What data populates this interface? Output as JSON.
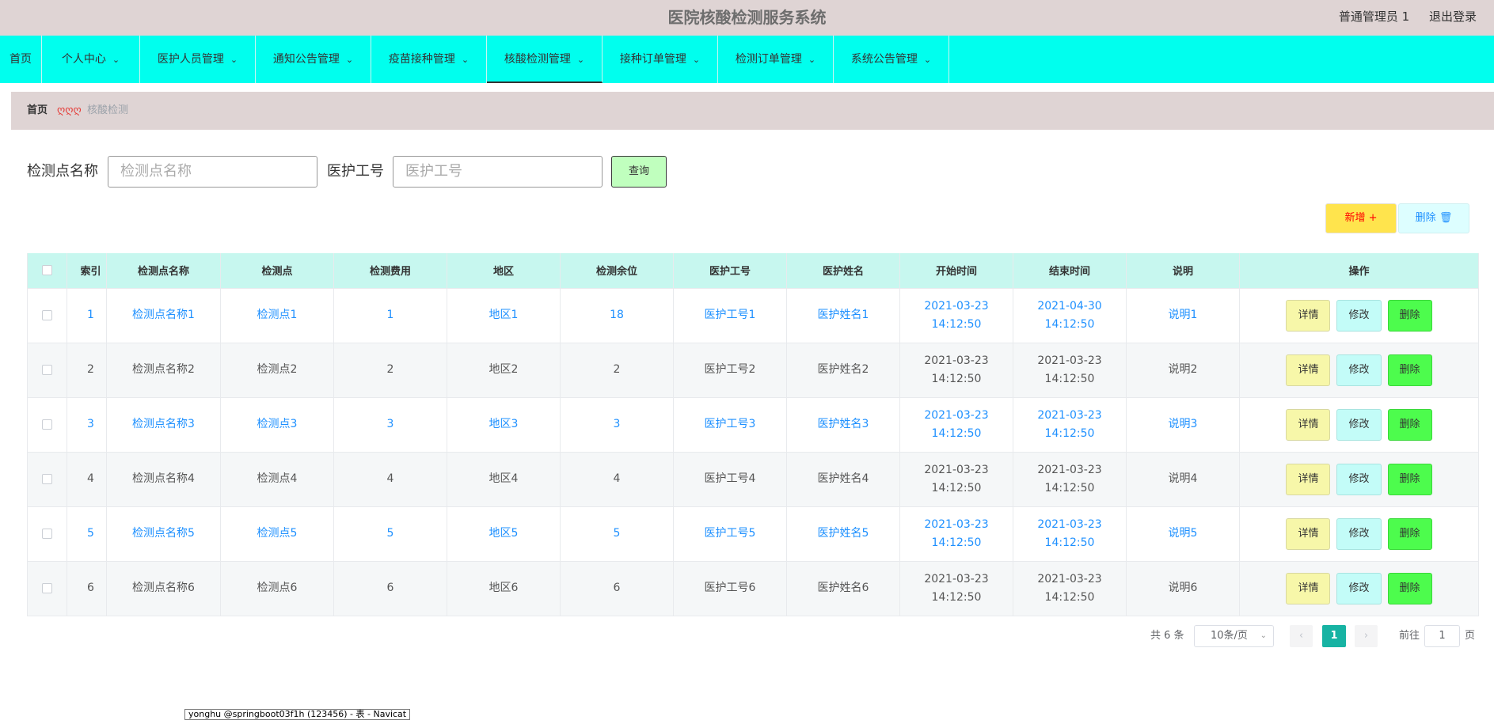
{
  "header": {
    "title": "医院核酸检测服务系统",
    "user": "普通管理员 1",
    "logout": "退出登录"
  },
  "nav": {
    "items": [
      {
        "label": "首页"
      },
      {
        "label": "个人中心"
      },
      {
        "label": "医护人员管理"
      },
      {
        "label": "通知公告管理"
      },
      {
        "label": "疫苗接种管理"
      },
      {
        "label": "核酸检测管理"
      },
      {
        "label": "接种订单管理"
      },
      {
        "label": "检测订单管理"
      },
      {
        "label": "系统公告管理"
      }
    ]
  },
  "breadcrumb": {
    "home": "首页",
    "separator": "ღღღ",
    "current": "核酸检测"
  },
  "search": {
    "field1_label": "检测点名称",
    "field1_placeholder": "检测点名称",
    "field2_label": "医护工号",
    "field2_placeholder": "医护工号",
    "query_button": "查询"
  },
  "toolbar": {
    "add_label": "新增",
    "delete_label": "删除"
  },
  "table": {
    "headers": [
      "索引",
      "检测点名称",
      "检测点",
      "检测费用",
      "地区",
      "检测余位",
      "医护工号",
      "医护姓名",
      "开始时间",
      "结束时间",
      "说明",
      "操作"
    ],
    "rows": [
      {
        "index": "1",
        "name": "检测点名称1",
        "point": "检测点1",
        "fee": "1",
        "region": "地区1",
        "remaining": "18",
        "staff_no": "医护工号1",
        "staff_name": "医护姓名1",
        "start": "2021-03-23 14:12:50",
        "end": "2021-04-30 14:12:50",
        "note": "说明1"
      },
      {
        "index": "2",
        "name": "检测点名称2",
        "point": "检测点2",
        "fee": "2",
        "region": "地区2",
        "remaining": "2",
        "staff_no": "医护工号2",
        "staff_name": "医护姓名2",
        "start": "2021-03-23 14:12:50",
        "end": "2021-03-23 14:12:50",
        "note": "说明2"
      },
      {
        "index": "3",
        "name": "检测点名称3",
        "point": "检测点3",
        "fee": "3",
        "region": "地区3",
        "remaining": "3",
        "staff_no": "医护工号3",
        "staff_name": "医护姓名3",
        "start": "2021-03-23 14:12:50",
        "end": "2021-03-23 14:12:50",
        "note": "说明3"
      },
      {
        "index": "4",
        "name": "检测点名称4",
        "point": "检测点4",
        "fee": "4",
        "region": "地区4",
        "remaining": "4",
        "staff_no": "医护工号4",
        "staff_name": "医护姓名4",
        "start": "2021-03-23 14:12:50",
        "end": "2021-03-23 14:12:50",
        "note": "说明4"
      },
      {
        "index": "5",
        "name": "检测点名称5",
        "point": "检测点5",
        "fee": "5",
        "region": "地区5",
        "remaining": "5",
        "staff_no": "医护工号5",
        "staff_name": "医护姓名5",
        "start": "2021-03-23 14:12:50",
        "end": "2021-03-23 14:12:50",
        "note": "说明5"
      },
      {
        "index": "6",
        "name": "检测点名称6",
        "point": "检测点6",
        "fee": "6",
        "region": "地区6",
        "remaining": "6",
        "staff_no": "医护工号6",
        "staff_name": "医护姓名6",
        "start": "2021-03-23 14:12:50",
        "end": "2021-03-23 14:12:50",
        "note": "说明6"
      }
    ],
    "actions": {
      "detail": "详情",
      "edit": "修改",
      "delete": "删除"
    }
  },
  "pagination": {
    "total": "共 6 条",
    "page_size": "10条/页",
    "current_page": "1",
    "goto_label": "前往",
    "goto_value": "1",
    "page_unit": "页"
  },
  "tooltip": {
    "text": "yonghu @springboot03f1h (123456) - 表 - Navicat"
  },
  "colors": {
    "nav_bg": "#00ffee",
    "header_bg": "#dfd4d4",
    "link_blue": "#1e90ff",
    "pager_active": "#17b3a3"
  }
}
